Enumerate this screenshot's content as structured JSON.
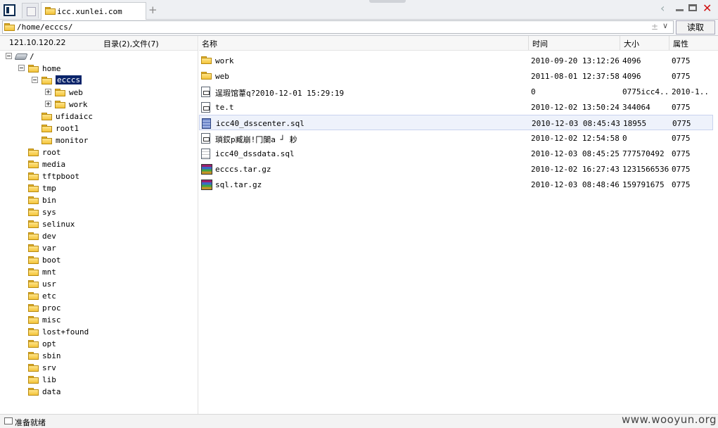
{
  "titlebar": {
    "tab_title": "icc.xunlei.com",
    "add_tab_label": "+"
  },
  "address": {
    "path": "/home/ecccs/",
    "read_button": "读取"
  },
  "left_panel": {
    "ip": "121.10.120.22",
    "counts": "目录(2),文件(7)"
  },
  "tree": [
    {
      "label": "/",
      "expander": "minus"
    },
    {
      "label": "home",
      "expander": "minus"
    },
    {
      "label": "ecccs",
      "expander": "minus",
      "selected": true
    },
    {
      "label": "web",
      "expander": "plus"
    },
    {
      "label": "work",
      "expander": "plus"
    },
    {
      "label": "ufidaicc"
    },
    {
      "label": "root1"
    },
    {
      "label": "monitor"
    },
    {
      "label": "root"
    },
    {
      "label": "media"
    },
    {
      "label": "tftpboot"
    },
    {
      "label": "tmp"
    },
    {
      "label": "bin"
    },
    {
      "label": "sys"
    },
    {
      "label": "selinux"
    },
    {
      "label": "dev"
    },
    {
      "label": "var"
    },
    {
      "label": "boot"
    },
    {
      "label": "mnt"
    },
    {
      "label": "usr"
    },
    {
      "label": "etc"
    },
    {
      "label": "proc"
    },
    {
      "label": "misc"
    },
    {
      "label": "lost+found"
    },
    {
      "label": "opt"
    },
    {
      "label": "sbin"
    },
    {
      "label": "srv"
    },
    {
      "label": "lib"
    },
    {
      "label": "data"
    }
  ],
  "columns": {
    "name": "名称",
    "time": "时间",
    "size": "大小",
    "attr": "属性"
  },
  "files": [
    {
      "icon": "folder-icon",
      "name": "work",
      "time": "2010-09-20 13:12:26",
      "size": "4096",
      "attr": "0775"
    },
    {
      "icon": "folder-icon",
      "name": "web",
      "time": "2011-08-01 12:37:58",
      "size": "4096",
      "attr": "0775"
    },
    {
      "icon": "document-icon",
      "name": "逞瑕馆葦q?2010-12-01 15:29:19",
      "time": "0",
      "size": "0775icc4...",
      "attr": "2010-1..."
    },
    {
      "icon": "document-icon",
      "name": "te.t",
      "time": "2010-12-02 13:50:24",
      "size": "344064",
      "attr": "0775"
    },
    {
      "icon": "sql-file-icon",
      "name": "icc40_dsscenter.sql",
      "time": "2010-12-03 08:45:43",
      "size": "18955",
      "attr": "0775",
      "selected": true
    },
    {
      "icon": "document-icon",
      "name": "  瑣銰p臧崩!冂闌a  ┘ 耖",
      "time": "2010-12-02 12:54:58",
      "size": "0",
      "attr": "0775"
    },
    {
      "icon": "text-file-icon",
      "name": "icc40_dssdata.sql",
      "time": "2010-12-03 08:45:25",
      "size": "777570492",
      "attr": "0775"
    },
    {
      "icon": "archive-icon",
      "name": "ecccs.tar.gz",
      "time": "2010-12-02 16:27:43",
      "size": "1231566536",
      "attr": "0775"
    },
    {
      "icon": "archive-icon",
      "name": "sql.tar.gz",
      "time": "2010-12-03 08:48:46",
      "size": "159791675",
      "attr": "0775"
    }
  ],
  "status": {
    "text": "准备就绪"
  },
  "watermark": "www.wooyun.org"
}
